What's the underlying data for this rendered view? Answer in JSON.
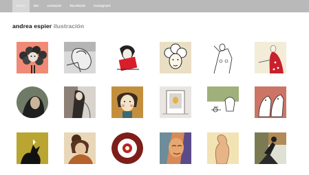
{
  "nav": {
    "items": [
      {
        "label": "inicio",
        "active": true
      },
      {
        "label": "bio",
        "active": false
      },
      {
        "label": "contacto",
        "active": false
      },
      {
        "label": "facebook",
        "active": false
      },
      {
        "label": "instagram",
        "active": false
      }
    ]
  },
  "brand": {
    "name": "andrea espier",
    "subtitle": "ilustración"
  },
  "colors": {
    "topbar": "#b9b9b9",
    "active_tab": "#d7d7d7",
    "brand_name": "#111111",
    "brand_subtitle": "#8a8a8a"
  },
  "gallery": {
    "rows": [
      [
        "balloons-illustration",
        "sketch-woman-illustration",
        "red-book-illustration",
        "curly-hair-illustration",
        "line-figure-illustration",
        "red-dress-illustration"
      ],
      [
        "round-portrait-illustration",
        "collage-woman-illustration",
        "girl-portrait-illustration",
        "window-frame-illustration",
        "green-room-illustration",
        "dog-couple-illustration"
      ],
      [
        "wolf-silhouette-illustration",
        "hair-bun-illustration",
        "target-circle-illustration",
        "colorful-face-illustration",
        "nude-figure-illustration",
        "rider-collage-illustration"
      ]
    ]
  }
}
